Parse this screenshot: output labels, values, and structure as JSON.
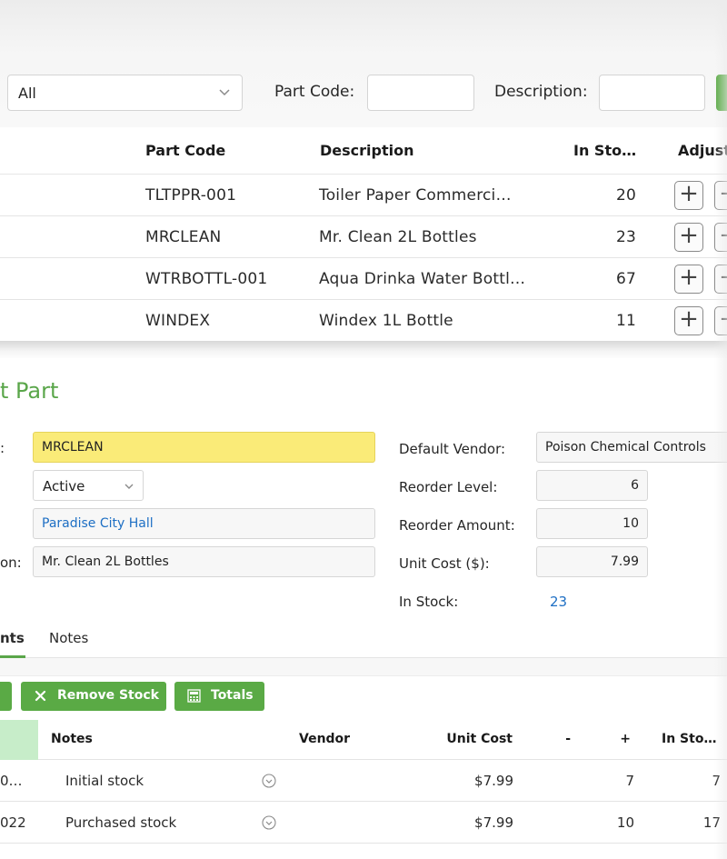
{
  "filters": {
    "category_value": "All",
    "part_code_label": "Part Code:",
    "part_code_value": "",
    "description_label": "Description:",
    "description_value": ""
  },
  "parts_table": {
    "columns": [
      "Part Code",
      "Description",
      "In Sto…",
      "Adjust"
    ],
    "rows": [
      {
        "code": "TLTPPR-001",
        "description": "Toiler Paper Commerci…",
        "in_stock": "20"
      },
      {
        "code": "MRCLEAN",
        "description": "Mr. Clean 2L Bottles",
        "in_stock": "23"
      },
      {
        "code": "WTRBOTTL-001",
        "description": "Aqua Drinka Water Bottl…",
        "in_stock": "67"
      },
      {
        "code": "WINDEX",
        "description": "Windex 1L Bottle",
        "in_stock": "11"
      }
    ],
    "add_glyph": "+",
    "remove_glyph": "−"
  },
  "edit_panel": {
    "title": "t Part",
    "part_code_label": ":",
    "part_code_value": "MRCLEAN",
    "status_value": "Active",
    "location_value": "Paradise City Hall",
    "description_label": "on:",
    "description_value": "Mr. Clean 2L Bottles",
    "default_vendor_label": "Default Vendor:",
    "default_vendor_value": "Poison Chemical Controls",
    "reorder_level_label": "Reorder Level:",
    "reorder_level_value": "6",
    "reorder_amount_label": "Reorder Amount:",
    "reorder_amount_value": "10",
    "unit_cost_label": "Unit Cost ($):",
    "unit_cost_value": "7.99",
    "in_stock_label": "In Stock:",
    "in_stock_value": "23"
  },
  "tabs": [
    {
      "label": "nts",
      "active": true
    },
    {
      "label": "Notes",
      "active": false
    }
  ],
  "actions": {
    "remove_stock_label": "Remove Stock",
    "totals_label": "Totals"
  },
  "ledger": {
    "columns": [
      "Notes",
      "Vendor",
      "Unit Cost",
      "-",
      "+",
      "In Sto…"
    ],
    "rows": [
      {
        "date": "0…",
        "notes": "Initial stock",
        "vendor": "",
        "unit_cost": "$7.99",
        "minus": "",
        "plus": "7",
        "in_stock": "7"
      },
      {
        "date": "022",
        "notes": "Purchased stock",
        "vendor": "",
        "unit_cost": "$7.99",
        "minus": "",
        "plus": "10",
        "in_stock": "17"
      }
    ]
  },
  "colors": {
    "accent_green": "#5aaa45",
    "highlight_yellow": "#faeb78",
    "link_blue": "#1e6fc4"
  }
}
